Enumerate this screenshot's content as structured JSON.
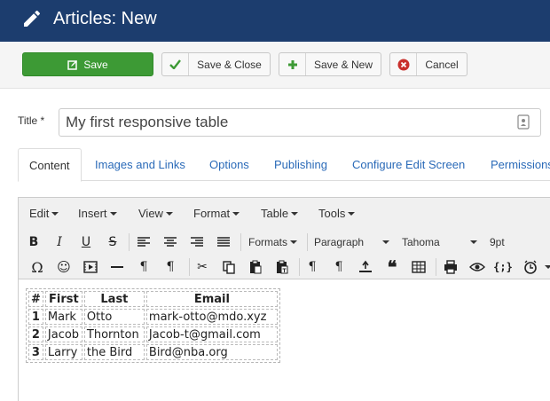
{
  "header": {
    "title": "Articles: New",
    "icon": "pencil-icon"
  },
  "toolbar": {
    "save": "Save",
    "save_close": "Save & Close",
    "save_new": "Save & New",
    "cancel": "Cancel"
  },
  "form": {
    "title_label": "Title *",
    "title_value": "My first responsive table"
  },
  "tabs": [
    "Content",
    "Images and Links",
    "Options",
    "Publishing",
    "Configure Edit Screen",
    "Permissions"
  ],
  "editor": {
    "menus": [
      "Edit",
      "Insert",
      "View",
      "Format",
      "Table",
      "Tools"
    ],
    "formats": "Formats",
    "block": "Paragraph",
    "font": "Tahoma",
    "size": "9pt"
  },
  "table": {
    "headers": [
      "#",
      "First",
      "Last",
      "Email"
    ],
    "rows": [
      [
        "1",
        "Mark",
        "Otto",
        "mark-otto@mdo.xyz"
      ],
      [
        "2",
        "Jacob",
        "Thornton",
        "Jacob-t@gmail.com"
      ],
      [
        "3",
        "Larry",
        "the Bird",
        "Bird@nba.org"
      ]
    ]
  },
  "colors": {
    "header_bg": "#1c3d6e",
    "save_green": "#3d9a35",
    "link_blue": "#2a6ab8",
    "cancel_red": "#c9302c"
  }
}
